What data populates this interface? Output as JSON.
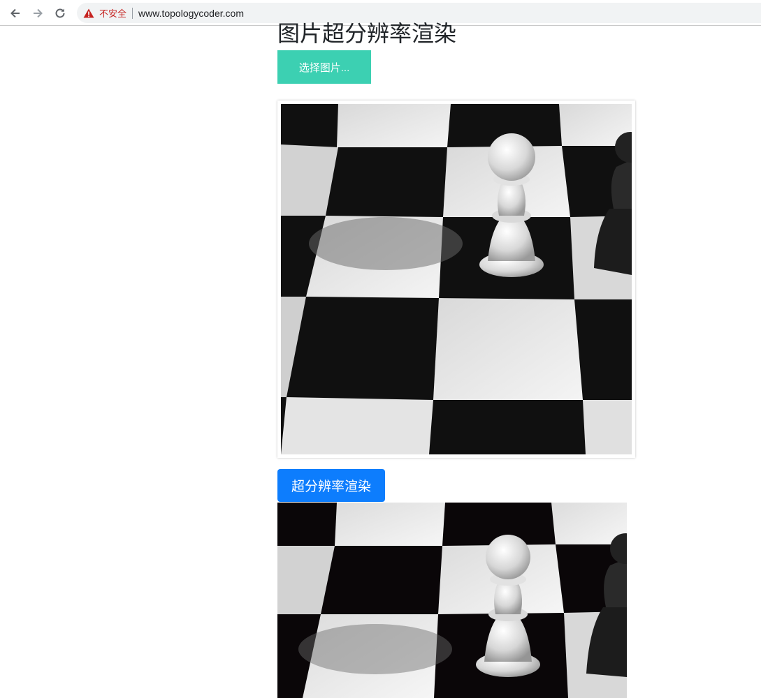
{
  "browser": {
    "back_icon": "arrow-left-icon",
    "forward_icon": "arrow-right-icon",
    "reload_icon": "reload-icon",
    "warning_icon": "warning-triangle-icon",
    "security_label": "不安全",
    "url": "www.topologycoder.com"
  },
  "page": {
    "title": "图片超分辨率渲染",
    "choose_button": "选择图片...",
    "render_button": "超分辨率渲染",
    "colors": {
      "choose_button_bg": "#3cd0b2",
      "render_button_bg": "#0d7dfd",
      "warning": "#c5221f"
    }
  }
}
